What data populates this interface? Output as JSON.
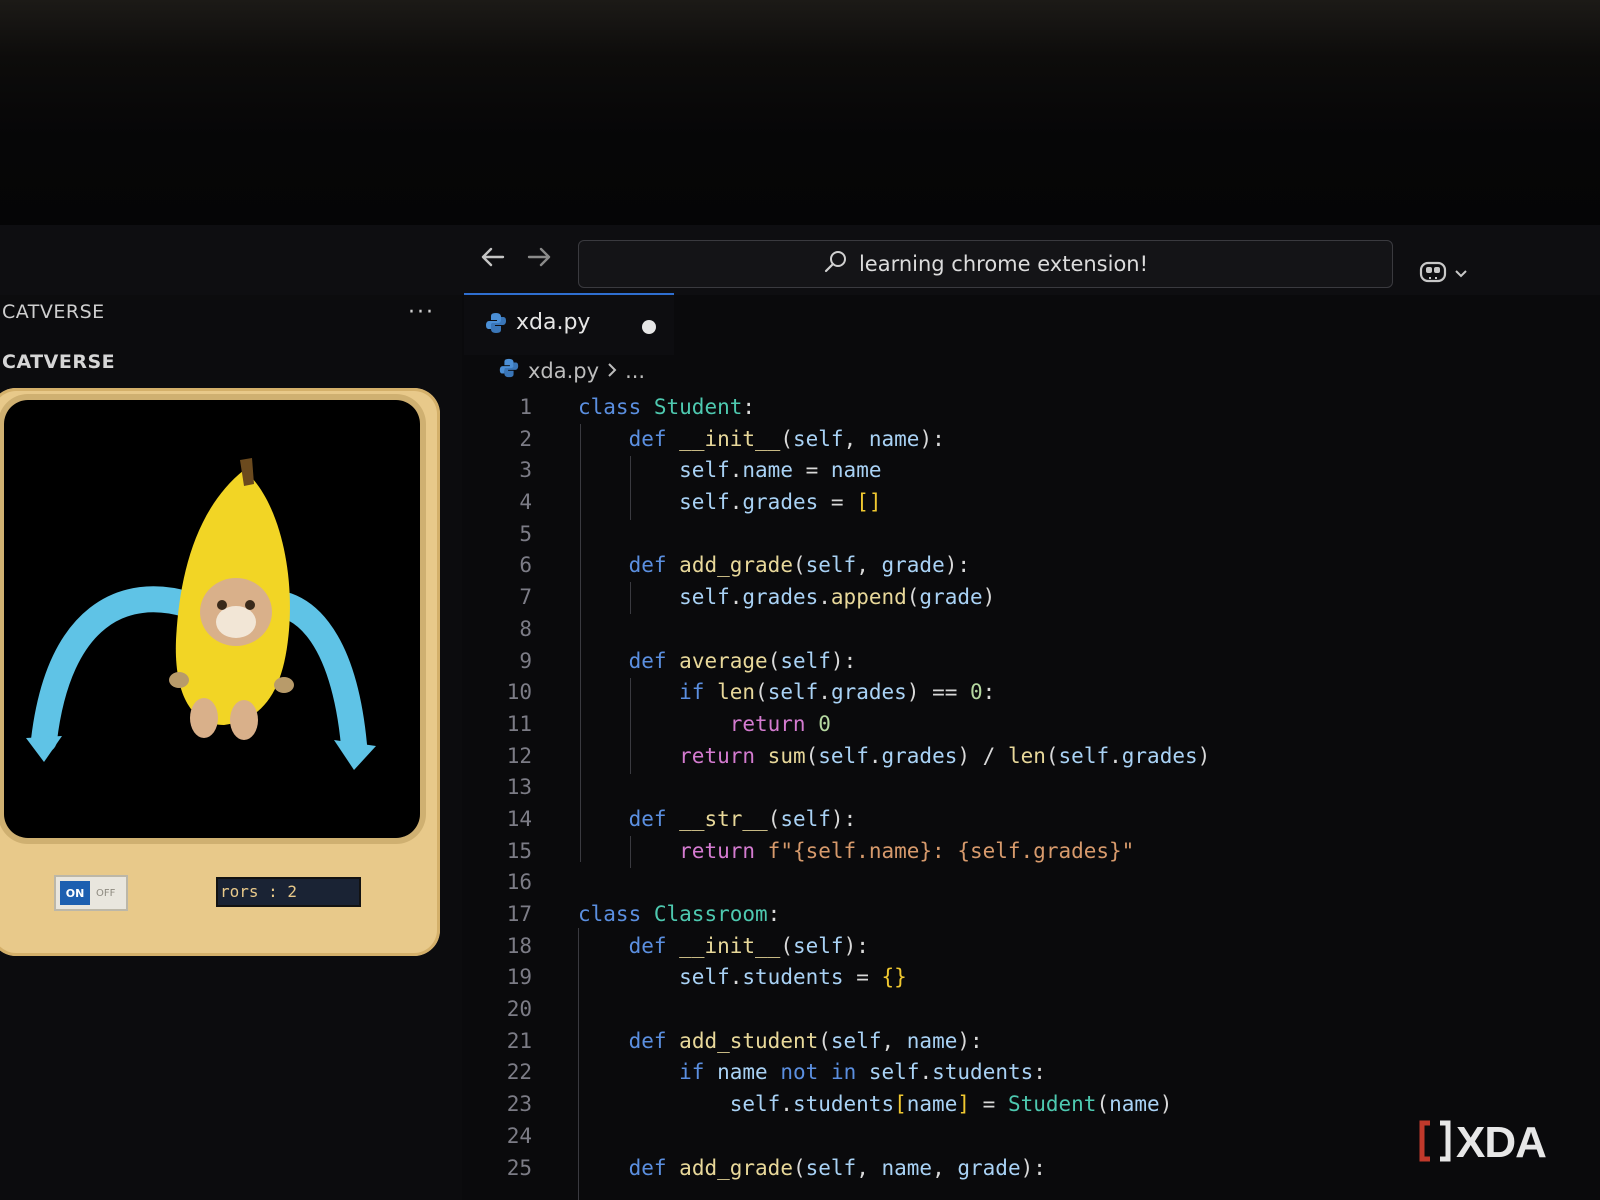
{
  "window": {
    "search_text": "learning chrome extension!"
  },
  "sidebar": {
    "title": "CATVERSE",
    "section_title": "CATVERSE",
    "more_label": "···",
    "toggle_on_label": "ON",
    "toggle_off_label": "OFF",
    "counter_text": "rors : 2"
  },
  "editor": {
    "tab_label": "xda.py",
    "breadcrumb_file": "xda.py",
    "breadcrumb_more": "...",
    "lines": [
      {
        "n": "1"
      },
      {
        "n": "2"
      },
      {
        "n": "3"
      },
      {
        "n": "4"
      },
      {
        "n": "5"
      },
      {
        "n": "6"
      },
      {
        "n": "7"
      },
      {
        "n": "8"
      },
      {
        "n": "9"
      },
      {
        "n": "10"
      },
      {
        "n": "11"
      },
      {
        "n": "12"
      },
      {
        "n": "13"
      },
      {
        "n": "14"
      },
      {
        "n": "15"
      },
      {
        "n": "16"
      },
      {
        "n": "17"
      },
      {
        "n": "18"
      },
      {
        "n": "19"
      },
      {
        "n": "20"
      },
      {
        "n": "21"
      },
      {
        "n": "22"
      },
      {
        "n": "23"
      },
      {
        "n": "24"
      },
      {
        "n": "25"
      }
    ],
    "code": [
      "class Student:",
      "    def __init__(self, name):",
      "        self.name = name",
      "        self.grades = []",
      "",
      "    def add_grade(self, grade):",
      "        self.grades.append(grade)",
      "",
      "    def average(self):",
      "        if len(self.grades) == 0:",
      "            return 0",
      "        return sum(self.grades) / len(self.grades)",
      "",
      "    def __str__(self):",
      "        return f\"{self.name}: {self.grades}\"",
      "",
      "class Classroom:",
      "    def __init__(self):",
      "        self.students = {}",
      "",
      "    def add_student(self, name):",
      "        if name not in self.students:",
      "            self.students[name] = Student(name)",
      "",
      "    def add_grade(self, name, grade):"
    ]
  },
  "watermark": {
    "brand": "XDA"
  },
  "colors": {
    "keyword": "#5b8fe0",
    "function": "#e8d89a",
    "class": "#4ec9b0",
    "variable": "#a9d2f5",
    "return": "#d47bd0",
    "card": "#e8c98a",
    "tab_accent": "#2f6fd1"
  },
  "icons": [
    "back-arrow-icon",
    "forward-arrow-icon",
    "search-icon",
    "copilot-icon",
    "chevron-down-icon",
    "python-file-icon",
    "chevron-right-icon",
    "xda-logo-icon"
  ]
}
